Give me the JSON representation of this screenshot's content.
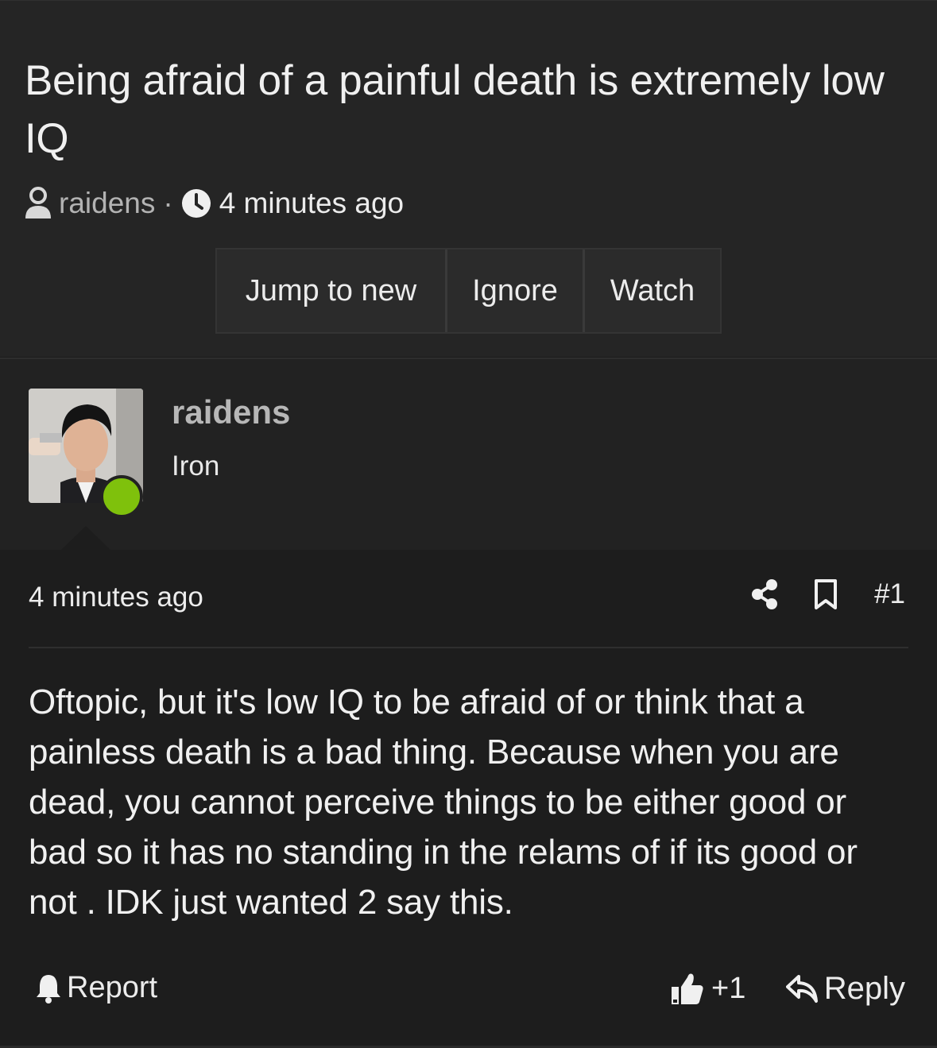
{
  "thread": {
    "title": "Being afraid of a painful death is extremely low IQ",
    "author": "raidens",
    "separator": "·",
    "time": "4 minutes ago"
  },
  "buttons": {
    "jump_to_new": "Jump to new",
    "ignore": "Ignore",
    "watch": "Watch"
  },
  "user": {
    "name": "raidens",
    "rank": "Iron",
    "online_color": "#7fc10c"
  },
  "post": {
    "time": "4 minutes ago",
    "number": "#1",
    "body": "Oftopic, but it's low IQ to be afraid of or think that a painless death is a bad thing. Because when you are dead, you cannot perceive things to be either good or bad so it has no standing in the relams of if its good or not . IDK just wanted 2 say this."
  },
  "footer": {
    "report": "Report",
    "likes": "+1",
    "reply": "Reply"
  },
  "icons": {
    "user": "user-icon",
    "clock": "clock-icon",
    "share": "share-icon",
    "bookmark": "bookmark-icon",
    "bell": "bell-icon",
    "thumb": "thumbs-up-icon",
    "reply": "reply-icon"
  }
}
